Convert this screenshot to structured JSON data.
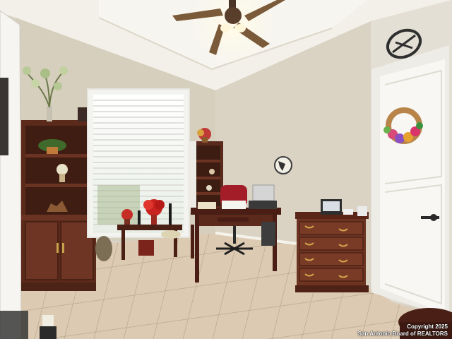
{
  "photo": {
    "copyright_line1": "Copyright 2025",
    "copyright_line2": "San Antonio Board of REALTORS"
  },
  "colors": {
    "ceiling": "#f4f1ea",
    "wall_left": "#d8d1bf",
    "wall_back": "#dcd6c8",
    "wall_right": "#e3ded3",
    "floor_tile": "#d9c9b4",
    "grout": "#b7a68f",
    "cabinet_wood": "#5a2a1c",
    "dresser_wood": "#6b3220",
    "door_white": "#f7f6f2",
    "blinds": "#f3f3f0",
    "trim": "#fbfaf6"
  }
}
